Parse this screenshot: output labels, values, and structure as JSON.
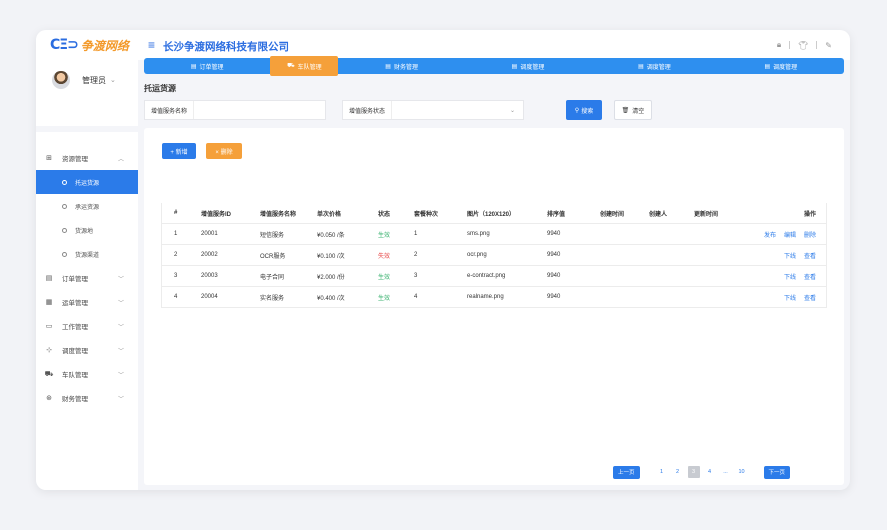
{
  "header": {
    "logo_mark": "CΞ⊃",
    "logo_text": "争渡网络",
    "company": "长沙争渡网络科技有限公司"
  },
  "sidebar": {
    "user_name": "管理员",
    "menu": [
      {
        "label": "资源管理",
        "icon": "grid-icon",
        "expanded": true,
        "children": [
          {
            "label": "托运货源",
            "active": true
          },
          {
            "label": "承运资源",
            "active": false
          },
          {
            "label": "货源地",
            "active": false
          },
          {
            "label": "货源渠道",
            "active": false
          }
        ]
      },
      {
        "label": "订单管理",
        "icon": "order-icon"
      },
      {
        "label": "运单管理",
        "icon": "waybill-icon"
      },
      {
        "label": "工作管理",
        "icon": "folder-icon"
      },
      {
        "label": "调度管理",
        "icon": "dispatch-icon"
      },
      {
        "label": "车队管理",
        "icon": "truck-icon"
      },
      {
        "label": "财务管理",
        "icon": "finance-icon"
      }
    ]
  },
  "tabs": [
    {
      "label": "订单管理",
      "active": false
    },
    {
      "label": "车队管理",
      "active": true
    },
    {
      "label": "财务管理",
      "active": false
    },
    {
      "label": "调度管理",
      "active": false
    },
    {
      "label": "调度管理",
      "active": false
    },
    {
      "label": "调度管理",
      "active": false
    }
  ],
  "page": {
    "title": "托运货源",
    "search": {
      "name_label": "增值服务名称",
      "name_value": "",
      "status_label": "增值服务状态",
      "status_value": "",
      "search_btn": "搜索",
      "clear_btn": "清空"
    },
    "add_btn": "+ 新增",
    "delete_btn": "× 删除"
  },
  "table": {
    "columns": [
      "#",
      "增值服务ID",
      "增值服务名称",
      "单次价格",
      "状态",
      "套餐种次",
      "图片（120X120）",
      "排序值",
      "创建时间",
      "创建人",
      "更新时间",
      "操作"
    ],
    "rows": [
      {
        "idx": "1",
        "id": "20001",
        "name": "短信服务",
        "price": "¥0.050 /条",
        "status": "生效",
        "ok": true,
        "rec": "1",
        "img": "sms.png",
        "sort": "9940",
        "ops": [
          "发布",
          "编辑",
          "删除"
        ]
      },
      {
        "idx": "2",
        "id": "20002",
        "name": "OCR服务",
        "price": "¥0.100 /次",
        "status": "失效",
        "ok": false,
        "rec": "2",
        "img": "ocr.png",
        "sort": "9940",
        "ops": [
          "下线",
          "查看"
        ]
      },
      {
        "idx": "3",
        "id": "20003",
        "name": "电子合同",
        "price": "¥2.000 /份",
        "status": "生效",
        "ok": true,
        "rec": "3",
        "img": "e-contract.png",
        "sort": "9940",
        "ops": [
          "下线",
          "查看"
        ]
      },
      {
        "idx": "4",
        "id": "20004",
        "name": "实名服务",
        "price": "¥0.400 /次",
        "status": "生效",
        "ok": true,
        "rec": "4",
        "img": "realname.png",
        "sort": "9940",
        "ops": [
          "下线",
          "查看"
        ]
      }
    ]
  },
  "pager": {
    "prev": "上一页",
    "next": "下一页",
    "pages": [
      "1",
      "2",
      "3",
      "4",
      "...",
      "10"
    ],
    "current": "3"
  },
  "colors": {
    "primary": "#2b7be9",
    "accent": "#f5a03a",
    "ok": "#3cb371",
    "bad": "#e84a4a"
  }
}
